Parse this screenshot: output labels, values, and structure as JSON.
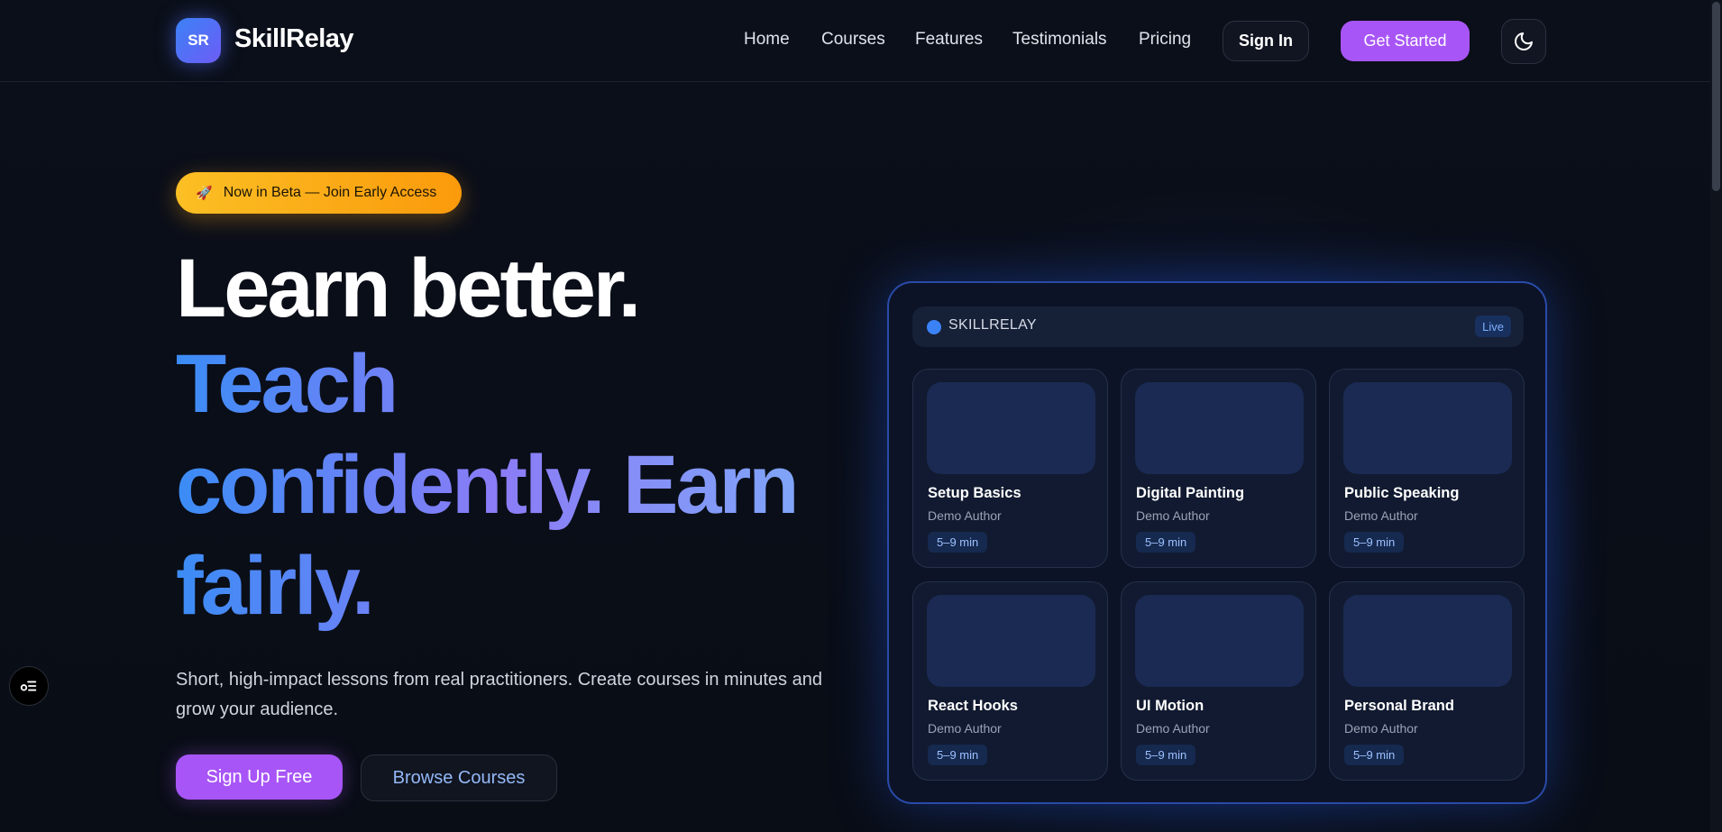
{
  "brand": {
    "badge": "SR",
    "name": "SkillRelay"
  },
  "nav": {
    "items": [
      {
        "label": "Home"
      },
      {
        "label": "Courses"
      },
      {
        "label": "Features"
      },
      {
        "label": "Testimonials"
      },
      {
        "label": "Pricing"
      }
    ],
    "sign_in": "Sign In",
    "get_started": "Get Started",
    "theme_icon": "moon-icon"
  },
  "hero": {
    "pill": {
      "icon": "🚀",
      "text": "Now in Beta — Join Early Access"
    },
    "headline_line1": "Learn better.",
    "headline_line2": "Teach",
    "headline_line3": "confidently. Earn",
    "headline_line4": "fairly.",
    "lead": "Short, high-impact lessons from real practitioners. Create courses in minutes and grow your audience.",
    "cta_primary": "Sign Up Free",
    "cta_secondary": "Browse Courses"
  },
  "preview": {
    "title": "SKILLRELAY",
    "status": "Live",
    "cards": [
      {
        "title": "Setup Basics",
        "author": "Demo Author",
        "duration": "5–9 min"
      },
      {
        "title": "Digital Painting",
        "author": "Demo Author",
        "duration": "5–9 min"
      },
      {
        "title": "Public Speaking",
        "author": "Demo Author",
        "duration": "5–9 min"
      },
      {
        "title": "React Hooks",
        "author": "Demo Author",
        "duration": "5–9 min"
      },
      {
        "title": "UI Motion",
        "author": "Demo Author",
        "duration": "5–9 min"
      },
      {
        "title": "Personal Brand",
        "author": "Demo Author",
        "duration": "5–9 min"
      }
    ]
  },
  "colors": {
    "background": "#0a0e18",
    "accent_purple": "#a855f7",
    "accent_blue": "#3b82f6",
    "pill_orange": "#fbbf24"
  }
}
